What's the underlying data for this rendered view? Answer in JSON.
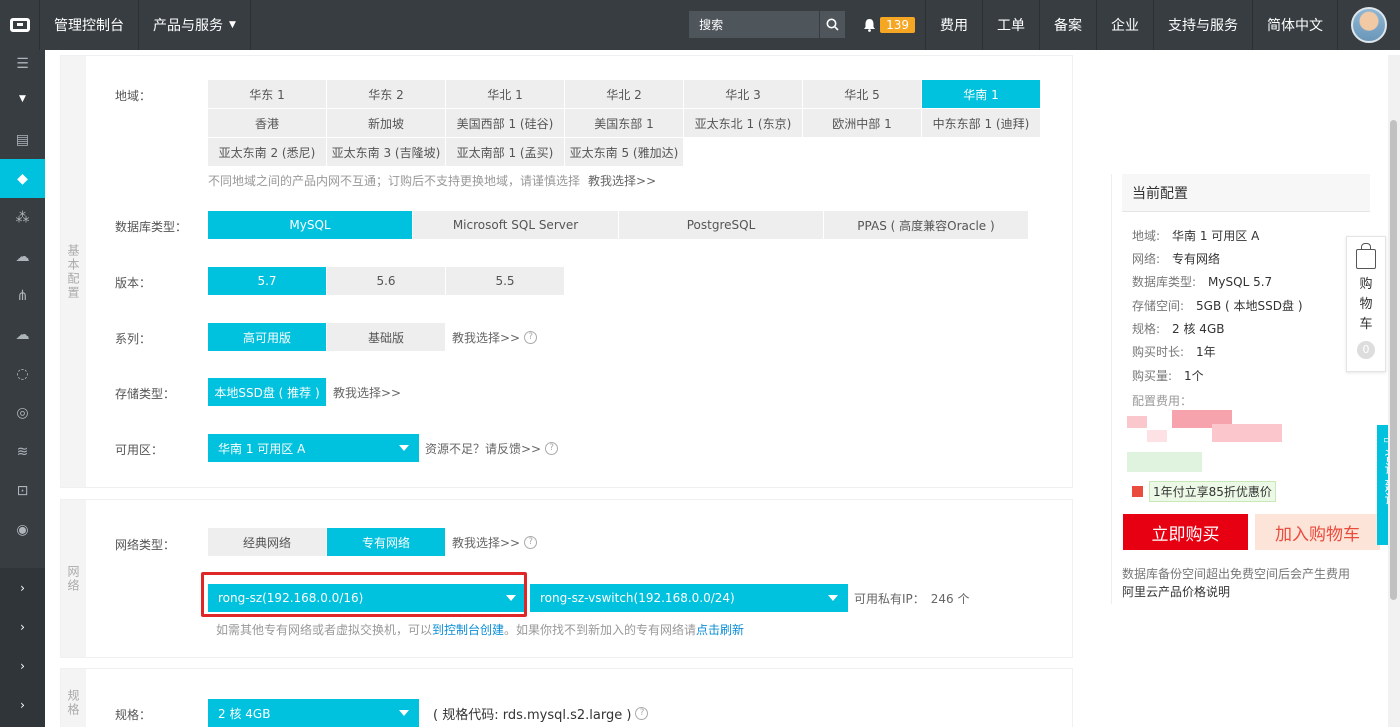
{
  "topbar": {
    "console": "管理控制台",
    "products": "产品与服务",
    "search_placeholder": "搜索",
    "notifications": "139",
    "links": [
      "费用",
      "工单",
      "备案",
      "企业",
      "支持与服务",
      "简体中文"
    ]
  },
  "panel_basic": {
    "tab": "基本配置",
    "region_label": "地域：",
    "regions_row1": [
      "华东 1",
      "华东 2",
      "华北 1",
      "华北 2",
      "华北 3",
      "华北 5",
      "华南 1"
    ],
    "regions_row2": [
      "香港",
      "新加坡",
      "美国西部 1 (硅谷)",
      "美国东部 1",
      "亚太东北 1 (东京)",
      "欧洲中部 1",
      "中东东部 1 (迪拜)"
    ],
    "regions_row3": [
      "亚太东南 2 (悉尼)",
      "亚太东南 3 (吉隆坡)",
      "亚太南部 1 (孟买)",
      "亚太东南 5 (雅加达)"
    ],
    "selected_region": "华南 1",
    "region_hint": "不同地域之间的产品内网不互通；订购后不支持更换地域，请谨慎选择",
    "teach_me": "教我选择>>",
    "db_type_label": "数据库类型：",
    "db_types": [
      "MySQL",
      "Microsoft SQL Server",
      "PostgreSQL",
      "PPAS ( 高度兼容Oracle )"
    ],
    "version_label": "版本：",
    "versions": [
      "5.7",
      "5.6",
      "5.5"
    ],
    "series_label": "系列：",
    "series": [
      "高可用版",
      "基础版"
    ],
    "storage_label": "存储类型：",
    "storage": "本地SSD盘 ( 推荐 )",
    "zone_label": "可用区：",
    "zone": "华南 1 可用区 A",
    "zone_hint": "资源不足？请反馈>>"
  },
  "panel_network": {
    "tab": "网络",
    "net_type_label": "网络类型：",
    "net_types": [
      "经典网络",
      "专有网络"
    ],
    "teach_me": "教我选择>>",
    "vpc": "rong-sz(192.168.0.0/16)",
    "vswitch": "rong-sz-vswitch(192.168.0.0/24)",
    "private_ip_label": "可用私有IP：",
    "private_ip_count": "246 个",
    "note_prefix": "如需其他专有网络或者虚拟交换机，可以",
    "note_link1": "到控制台创建",
    "note_middle": "。如果你找不到新加入的专有网络请",
    "note_link2": "点击刷新"
  },
  "panel_spec": {
    "tab": "规格",
    "spec_label": "规格：",
    "spec": "2 核 4GB",
    "spec_code": "( 规格代码: rds.mysql.s2.large )"
  },
  "summary": {
    "title": "当前配置",
    "lines": [
      {
        "k": "地域:",
        "v": "华南 1 可用区 A"
      },
      {
        "k": "网络:",
        "v": "专有网络"
      },
      {
        "k": "数据库类型:",
        "v": "MySQL 5.7"
      },
      {
        "k": "存储空间:",
        "v": "5GB ( 本地SSD盘 )"
      },
      {
        "k": "规格:",
        "v": "2 核 4GB"
      },
      {
        "k": "购买时长:",
        "v": "1年"
      },
      {
        "k": "购买量:",
        "v": "1个"
      }
    ],
    "fee_label": "配置费用：",
    "promo": "1年付立享85折优惠价",
    "buy": "立即购买",
    "add_cart": "加入购物车",
    "note1": "数据库备份空间超出免费空间后会产生费用",
    "note2": "阿里云产品价格说明"
  },
  "cart": {
    "label": "购物车",
    "count": "0"
  },
  "consult": {
    "label": "咨询·建议"
  },
  "colors": {
    "accent": "#00c1de",
    "buy": "#e60012",
    "topbar": "#373d41"
  }
}
